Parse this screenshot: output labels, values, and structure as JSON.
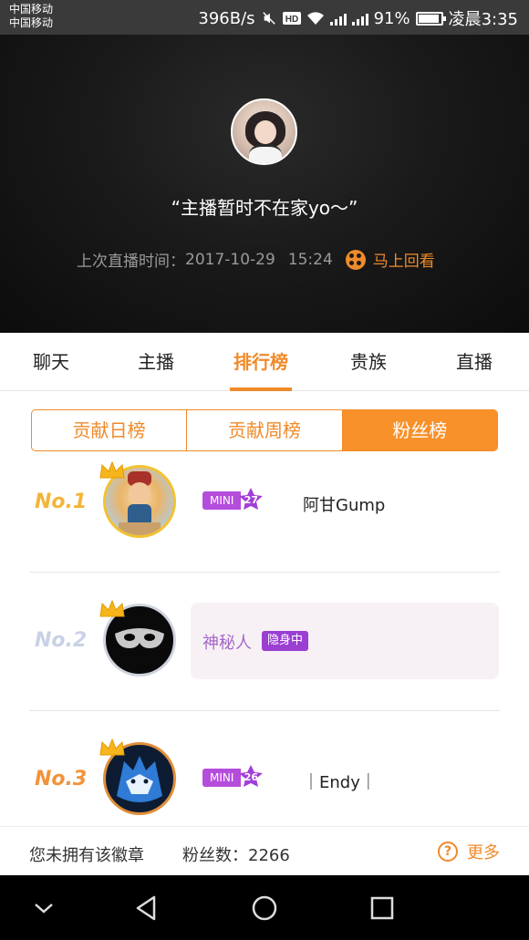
{
  "status_bar": {
    "carrier_1": "中国移动",
    "carrier_2": "中国移动",
    "speed": "396B/s",
    "battery": "91%",
    "time": "凌晨3:35",
    "icons": [
      "mute-icon",
      "hd-icon",
      "wifi-icon",
      "4g-signal-icon",
      "2g-signal-icon",
      "battery-icon"
    ]
  },
  "hero": {
    "quote": "“主播暂时不在家yo～”",
    "last_live_label": "上次直播时间：",
    "last_live_date": "2017-10-29",
    "last_live_time": "15:24",
    "replay_label": "马上回看",
    "accent": "#f08a2a"
  },
  "tabs": [
    {
      "label": "聊天",
      "active": false
    },
    {
      "label": "主播",
      "active": false
    },
    {
      "label": "排行榜",
      "active": true
    },
    {
      "label": "贵族",
      "active": false
    },
    {
      "label": "直播",
      "active": false
    }
  ],
  "segments": [
    {
      "label": "贡献日榜",
      "active": false
    },
    {
      "label": "贡献周榜",
      "active": false
    },
    {
      "label": "粉丝榜",
      "active": true
    }
  ],
  "ranking": [
    {
      "rank": "No.1",
      "badge": "MINI",
      "level": "27",
      "name": "阿甘Gump"
    },
    {
      "rank": "No.2",
      "name": "神秘人",
      "status": "隐身中"
    },
    {
      "rank": "No.3",
      "badge": "MINI",
      "level": "26",
      "name": "｜Endy｜"
    }
  ],
  "footer": {
    "no_badge": "您未拥有该徽章",
    "fans_label": "粉丝数：",
    "fans_count": "2266",
    "more": "更多"
  },
  "navbar": {
    "icons": [
      "collapse-down-icon",
      "back-icon",
      "home-icon",
      "recents-icon"
    ]
  }
}
